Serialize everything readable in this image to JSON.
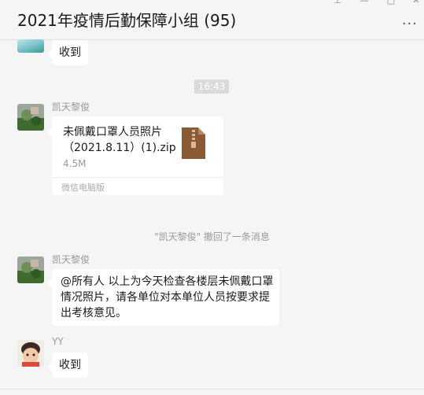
{
  "window": {
    "title": "2021年疫情后勤保障小组 (95)",
    "controls": [
      "pin-icon",
      "minimize-icon",
      "maximize-icon",
      "close-icon"
    ]
  },
  "messages": {
    "first_reply": "收到",
    "timestamp": "16:43",
    "file_msg": {
      "sender": "凯天黎俊",
      "file_name": "未佩戴口罩人员照片（2021.8.11）(1).zip",
      "file_size": "4.5M",
      "source": "微信电脑版"
    },
    "recall_note": "\"凯天黎俊\" 撤回了一条消息",
    "text_msg": {
      "sender": "凯天黎俊",
      "line1": "@所有人 以上为今天检查各楼层未佩戴口罩",
      "line2": "情况照片，请各单位对本单位人员按要求提",
      "line3": "出考核意见。"
    },
    "yy_msg": {
      "sender": "YY",
      "text": "收到"
    }
  },
  "colors": {
    "background": "#f5f5f5",
    "bubble": "#ffffff",
    "zip_icon": "#8a5a34",
    "muted_text": "#999999"
  }
}
